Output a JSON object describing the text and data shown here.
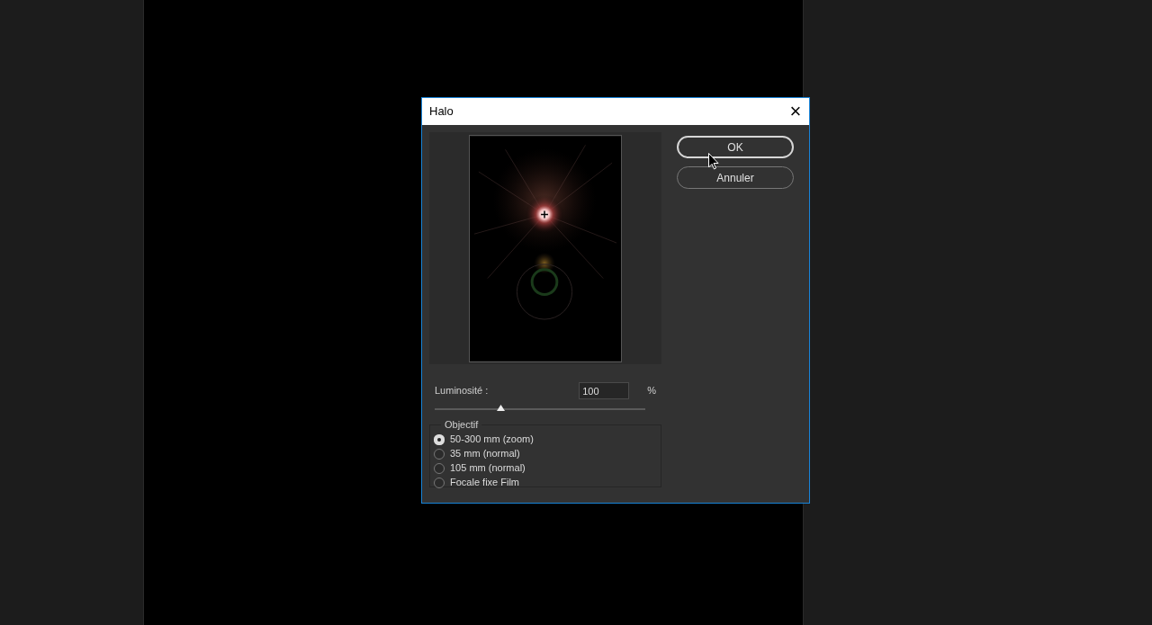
{
  "dialog": {
    "title": "Halo",
    "close": "×"
  },
  "buttons": [
    {
      "label": "OK",
      "default": true
    },
    {
      "label": "Annuler",
      "default": false
    }
  ],
  "brightness": {
    "label": "Luminosité :",
    "value": "100",
    "unit": "%",
    "level": 0.31
  },
  "lens": {
    "legend": "Objectif",
    "options": [
      {
        "label": "50-300 mm (zoom)",
        "selected": true
      },
      {
        "label": "35 mm (normal)",
        "selected": false
      },
      {
        "label": "105 mm  (normal)",
        "selected": false
      },
      {
        "label": "Focale fixe Film",
        "selected": false
      }
    ]
  }
}
